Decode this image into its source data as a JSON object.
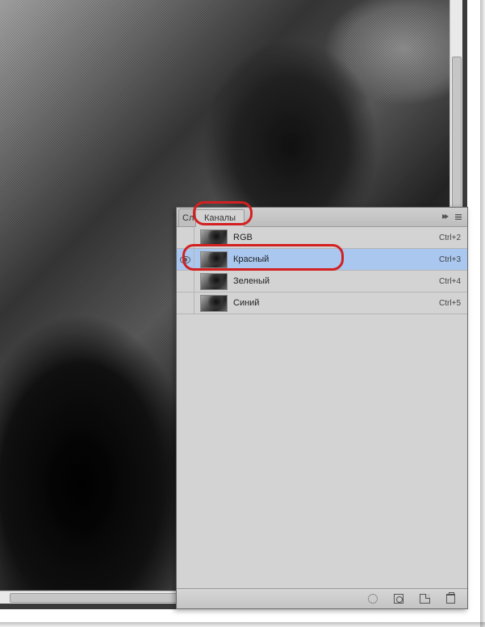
{
  "tabs": {
    "layers": "Сло",
    "channels": "Каналы"
  },
  "channels": [
    {
      "visible": false,
      "name": "RGB",
      "shortcut": "Ctrl+2",
      "selected": false
    },
    {
      "visible": true,
      "name": "Красный",
      "shortcut": "Ctrl+3",
      "selected": true
    },
    {
      "visible": false,
      "name": "Зеленый",
      "shortcut": "Ctrl+4",
      "selected": false
    },
    {
      "visible": false,
      "name": "Синий",
      "shortcut": "Ctrl+5",
      "selected": false
    }
  ],
  "icons": {
    "panel_menu": "panel-menu-icon",
    "panel_flyout": "flyout-icon",
    "load_selection": "load-selection-icon",
    "save_mask": "save-mask-icon",
    "new_channel": "new-channel-icon",
    "delete_channel": "trash-icon"
  }
}
